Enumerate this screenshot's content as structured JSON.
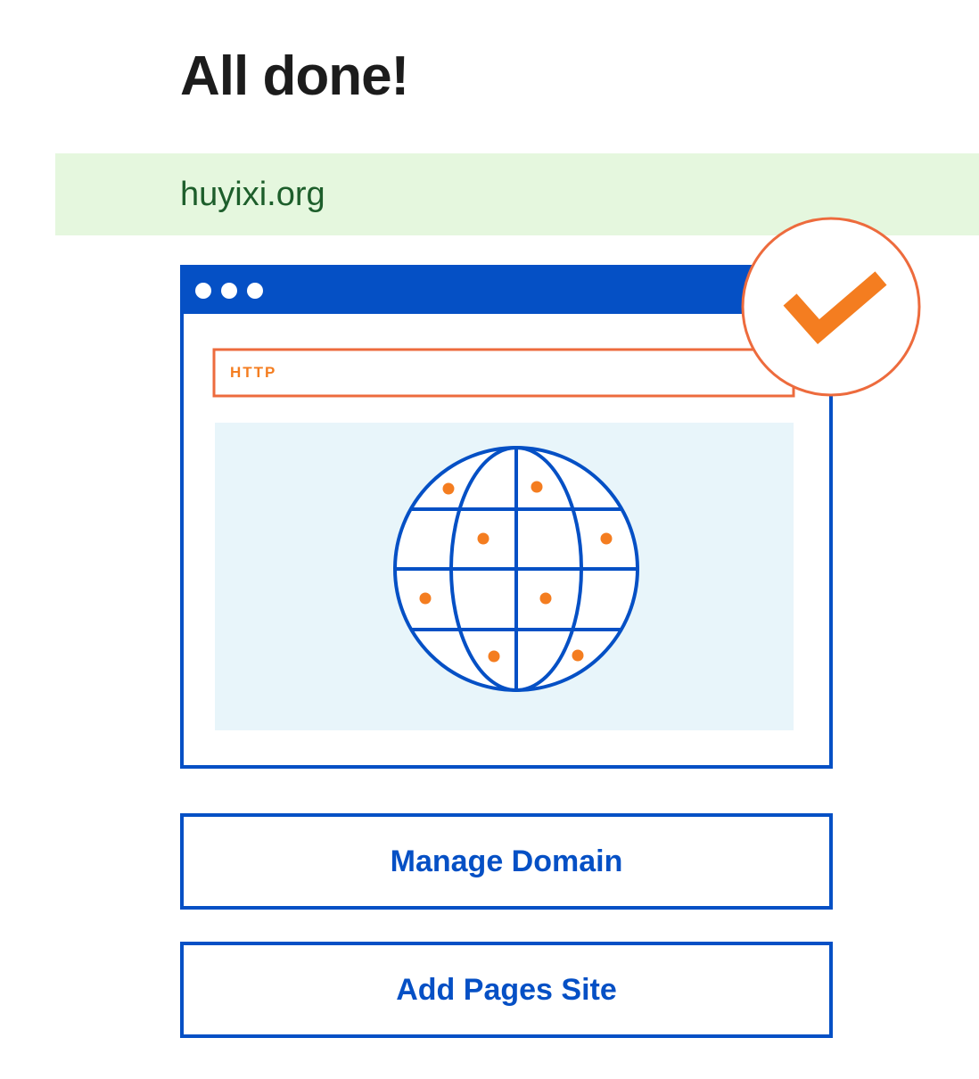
{
  "heading": "All done!",
  "domain": "huyixi.org",
  "illustration": {
    "address_bar_label": "HTTP",
    "colors": {
      "blue": "#0550c5",
      "orange": "#f47d20",
      "orange_border": "#ed6b3d",
      "panel": "#e8f5fa"
    },
    "icons": [
      "window-dots-icon",
      "globe-icon",
      "checkmark-icon"
    ]
  },
  "actions": {
    "manage_domain": "Manage Domain",
    "add_pages_site": "Add Pages Site"
  }
}
